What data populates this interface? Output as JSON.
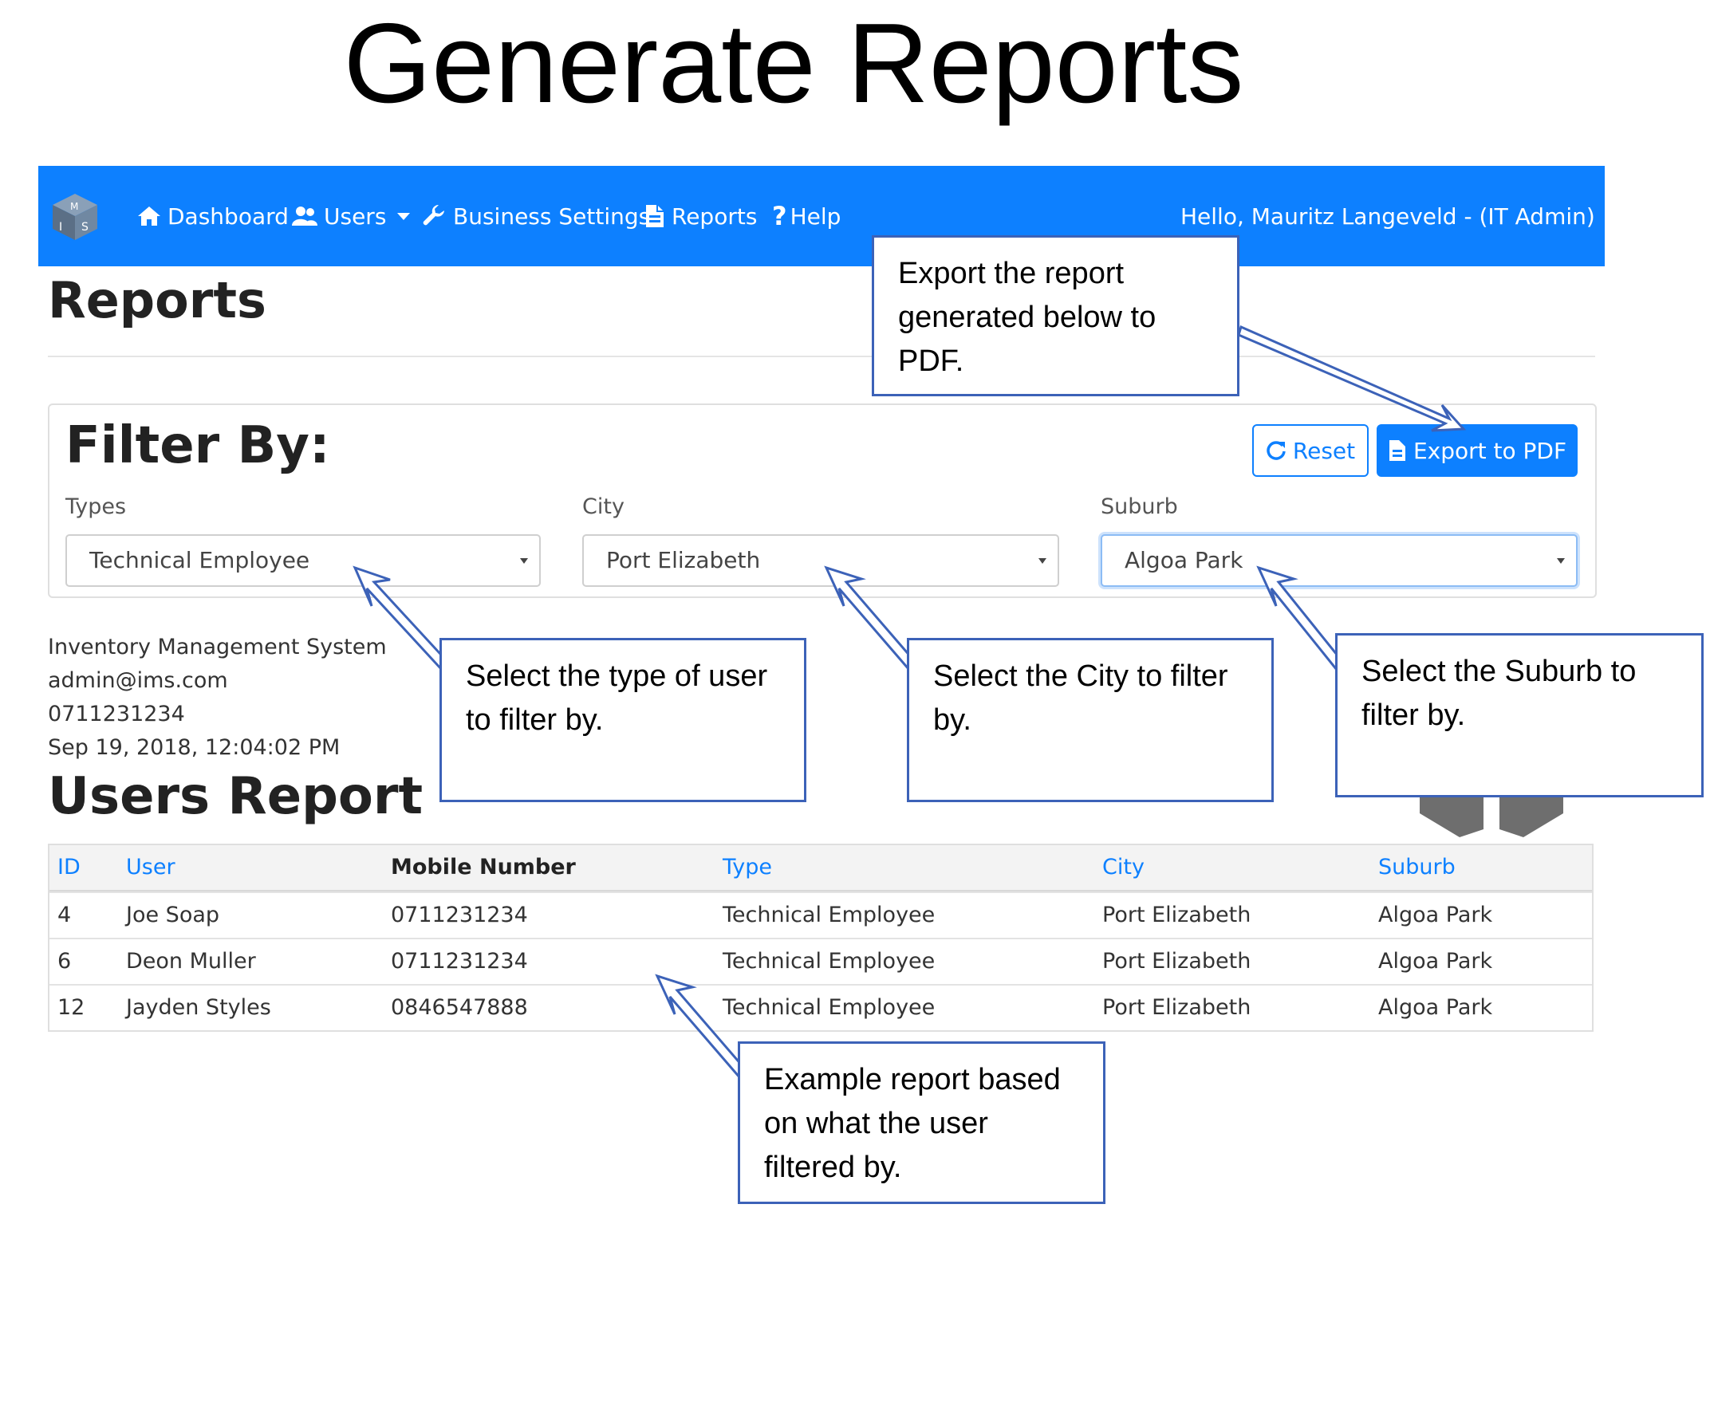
{
  "slide_title": "Generate Reports",
  "navbar": {
    "brand": {
      "letters": [
        "M",
        "I",
        "S"
      ]
    },
    "items": [
      {
        "label": "Dashboard",
        "icon": "home-icon"
      },
      {
        "label": "Users",
        "icon": "users-icon",
        "dropdown": true
      },
      {
        "label": "Business Settings",
        "icon": "wrench-icon"
      },
      {
        "label": "Reports",
        "icon": "report-icon"
      },
      {
        "label": "Help",
        "icon": "question-icon",
        "icon_text": "?"
      }
    ],
    "user_menu": "Hello, Mauritz Langeveld - (IT Admin)"
  },
  "page_title": "Reports",
  "filter": {
    "title": "Filter By:",
    "reset_label": "Reset",
    "export_label": "Export to PDF",
    "types": {
      "label": "Types",
      "value": "Technical Employee"
    },
    "city": {
      "label": "City",
      "value": "Port Elizabeth"
    },
    "suburb": {
      "label": "Suburb",
      "value": "Algoa Park"
    }
  },
  "company": {
    "name": "Inventory Management System",
    "email": "admin@ims.com",
    "phone": "0711231234",
    "timestamp": "Sep 19, 2018, 12:04:02 PM"
  },
  "report": {
    "title": "Users Report",
    "columns": [
      "ID",
      "User",
      "Mobile Number",
      "Type",
      "City",
      "Suburb"
    ],
    "rows": [
      [
        "4",
        "Joe Soap",
        "0711231234",
        "Technical Employee",
        "Port Elizabeth",
        "Algoa Park"
      ],
      [
        "6",
        "Deon Muller",
        "0711231234",
        "Technical Employee",
        "Port Elizabeth",
        "Algoa Park"
      ],
      [
        "12",
        "Jayden Styles",
        "0846547888",
        "Technical Employee",
        "Port Elizabeth",
        "Algoa Park"
      ]
    ]
  },
  "callouts": {
    "export": [
      "Export the report",
      "generated below to",
      "PDF."
    ],
    "type": [
      "Select the type of user",
      "to filter by."
    ],
    "city": [
      "Select the City to filter",
      "by."
    ],
    "suburb": [
      "Select the Suburb to",
      "filter by."
    ],
    "example": [
      "Example report based",
      "on what the user",
      "filtered by."
    ]
  },
  "colors": {
    "primary": "#0d80ff",
    "callout_border": "#3c62b8"
  }
}
